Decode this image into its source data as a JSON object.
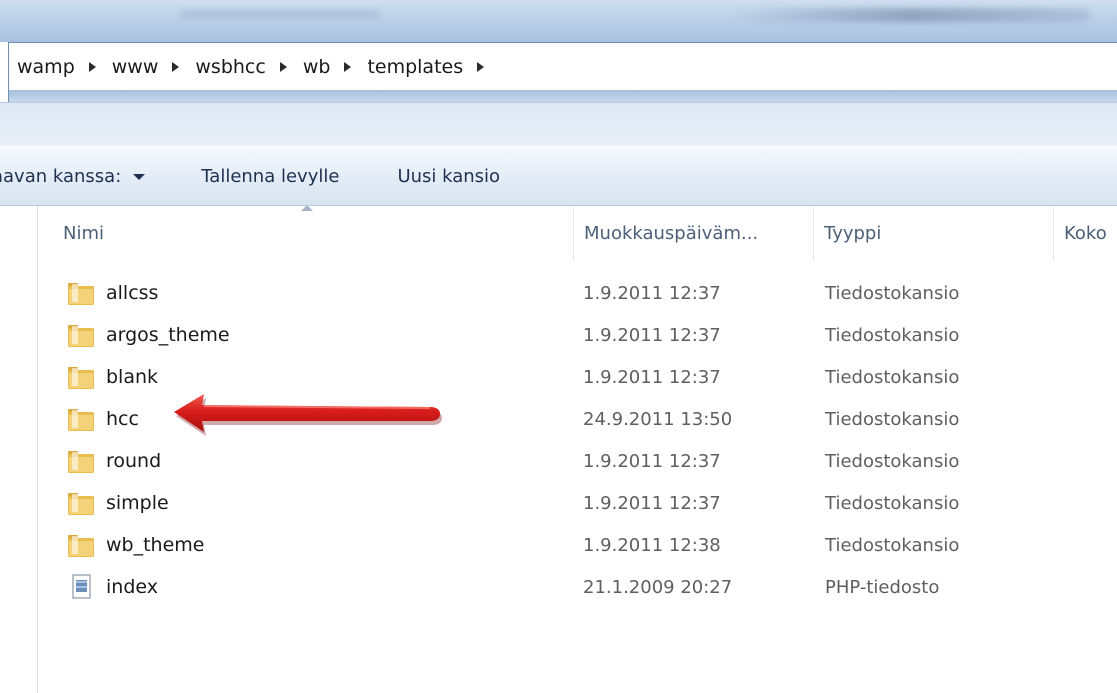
{
  "address": {
    "crumbs": [
      "wamp",
      "www",
      "wsbhcc",
      "wb",
      "templates"
    ]
  },
  "toolbar": {
    "share_label": "aavan kanssa:",
    "save_label": "Tallenna levylle",
    "new_folder_label": "Uusi kansio"
  },
  "columns": {
    "name": "Nimi",
    "modified": "Muokkauspäiväm...",
    "type": "Tyyppi",
    "size": "Koko"
  },
  "files": [
    {
      "name": "allcss",
      "modified": "1.9.2011 12:37",
      "type": "Tiedostokansio",
      "icon": "folder-icon"
    },
    {
      "name": "argos_theme",
      "modified": "1.9.2011 12:37",
      "type": "Tiedostokansio",
      "icon": "folder-icon"
    },
    {
      "name": "blank",
      "modified": "1.9.2011 12:37",
      "type": "Tiedostokansio",
      "icon": "folder-icon"
    },
    {
      "name": "hcc",
      "modified": "24.9.2011 13:50",
      "type": "Tiedostokansio",
      "icon": "folder-icon"
    },
    {
      "name": "round",
      "modified": "1.9.2011 12:37",
      "type": "Tiedostokansio",
      "icon": "folder-icon"
    },
    {
      "name": "simple",
      "modified": "1.9.2011 12:37",
      "type": "Tiedostokansio",
      "icon": "folder-icon"
    },
    {
      "name": "wb_theme",
      "modified": "1.9.2011 12:38",
      "type": "Tiedostokansio",
      "icon": "folder-icon"
    },
    {
      "name": "index",
      "modified": "21.1.2009 20:27",
      "type": "PHP-tiedosto",
      "icon": "file-icon"
    }
  ],
  "annotation": {
    "icon": "red-arrow-icon",
    "color": "#d91c1c"
  }
}
